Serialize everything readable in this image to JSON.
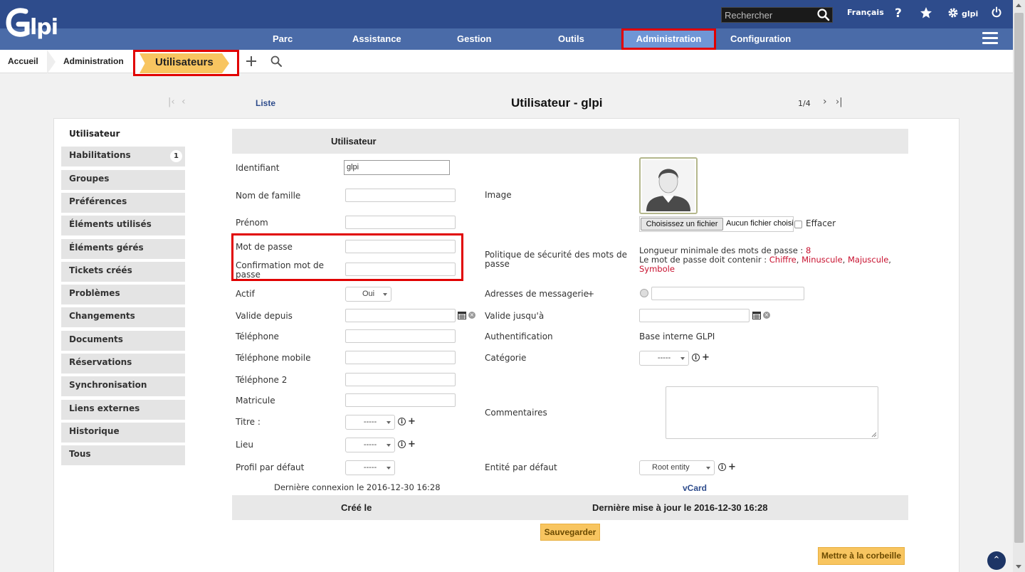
{
  "header": {
    "search_placeholder": "Rechercher",
    "language": "Français",
    "user": "glpi",
    "menu": [
      "Parc",
      "Assistance",
      "Gestion",
      "Outils",
      "Administration",
      "Configuration"
    ]
  },
  "breadcrumb": {
    "home": "Accueil",
    "section": "Administration",
    "current": "Utilisateurs"
  },
  "nav": {
    "list_link": "Liste",
    "title": "Utilisateur - glpi",
    "pager": "1/4"
  },
  "sidebar": {
    "items": [
      {
        "label": "Utilisateur"
      },
      {
        "label": "Habilitations",
        "badge": "1"
      },
      {
        "label": "Groupes"
      },
      {
        "label": "Préférences"
      },
      {
        "label": "Éléments utilisés"
      },
      {
        "label": "Éléments gérés"
      },
      {
        "label": "Tickets créés"
      },
      {
        "label": "Problèmes"
      },
      {
        "label": "Changements"
      },
      {
        "label": "Documents"
      },
      {
        "label": "Réservations"
      },
      {
        "label": "Synchronisation"
      },
      {
        "label": "Liens externes"
      },
      {
        "label": "Historique"
      },
      {
        "label": "Tous"
      }
    ]
  },
  "form": {
    "section_title": "Utilisateur",
    "identifiant_label": "Identifiant",
    "identifiant_value": "glpi",
    "nom_label": "Nom de famille",
    "prenom_label": "Prénom",
    "image_label": "Image",
    "file_button": "Choisissez un fichier",
    "file_none": "Aucun fichier choisi",
    "effacer_label": "Effacer",
    "password_label": "Mot de passe",
    "password_confirm_label": "Confirmation mot de passe",
    "policy_label": "Politique de sécurité des mots de passe",
    "policy_line1_prefix": "Longueur minimale des mots de passe :",
    "policy_min_length": "8",
    "policy_line2_prefix": "Le mot de passe doit contenir :",
    "policy_req1": "Chiffre",
    "policy_req2": "Minuscule",
    "policy_req3": "Majuscule",
    "policy_req4": "Symbole",
    "actif_label": "Actif",
    "actif_value": "Oui",
    "emails_label": "Adresses de messagerie",
    "valide_depuis_label": "Valide depuis",
    "valide_jusqua_label": "Valide jusqu'à",
    "telephone_label": "Téléphone",
    "auth_label": "Authentification",
    "auth_value": "Base interne GLPI",
    "tel_mobile_label": "Téléphone mobile",
    "categorie_label": "Catégorie",
    "categorie_value": "-----",
    "tel2_label": "Téléphone 2",
    "matricule_label": "Matricule",
    "commentaires_label": "Commentaires",
    "titre_label": "Titre :",
    "titre_value": "-----",
    "lieu_label": "Lieu",
    "lieu_value": "-----",
    "profil_label": "Profil par défaut",
    "profil_value": "-----",
    "entite_label": "Entité par défaut",
    "entite_value": "Root entity",
    "last_login": "Dernière connexion le 2016-12-30 16:28",
    "vcard": "vCard",
    "created_label": "Créé le",
    "updated_label": "Dernière mise à jour le 2016-12-30 16:28",
    "save_button": "Sauvegarder",
    "trash_button": "Mettre à la corbeille"
  },
  "colors": {
    "header": "#2e4c8c",
    "menubar": "#4a6ba8",
    "accent": "#f8c560",
    "highlight": "#e10000"
  }
}
